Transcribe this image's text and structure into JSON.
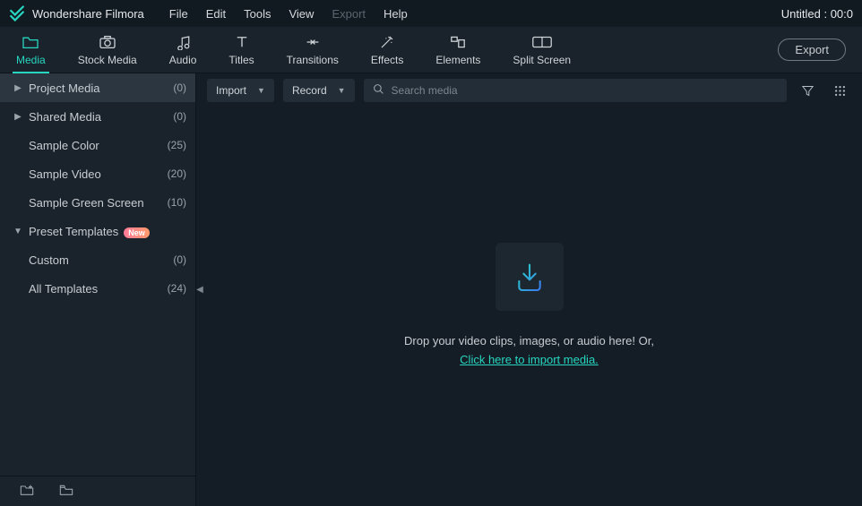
{
  "titlebar": {
    "app_name": "Wondershare Filmora",
    "menus": [
      {
        "label": "File",
        "disabled": false
      },
      {
        "label": "Edit",
        "disabled": false
      },
      {
        "label": "Tools",
        "disabled": false
      },
      {
        "label": "View",
        "disabled": false
      },
      {
        "label": "Export",
        "disabled": true
      },
      {
        "label": "Help",
        "disabled": false
      }
    ],
    "right_text": "Untitled : 00:0"
  },
  "toolbar": {
    "tabs": [
      {
        "label": "Media",
        "icon": "folder-icon",
        "active": true
      },
      {
        "label": "Stock Media",
        "icon": "camera-icon",
        "active": false
      },
      {
        "label": "Audio",
        "icon": "music-icon",
        "active": false
      },
      {
        "label": "Titles",
        "icon": "text-icon",
        "active": false
      },
      {
        "label": "Transitions",
        "icon": "transitions-icon",
        "active": false
      },
      {
        "label": "Effects",
        "icon": "effects-icon",
        "active": false
      },
      {
        "label": "Elements",
        "icon": "elements-icon",
        "active": false
      },
      {
        "label": "Split Screen",
        "icon": "split-icon",
        "active": false
      }
    ],
    "export_label": "Export"
  },
  "sidebar": {
    "items": [
      {
        "label": "Project Media",
        "count": "(0)",
        "arrow": "right",
        "active": true,
        "child": false,
        "badge": false
      },
      {
        "label": "Shared Media",
        "count": "(0)",
        "arrow": "right",
        "active": false,
        "child": false,
        "badge": false
      },
      {
        "label": "Sample Color",
        "count": "(25)",
        "arrow": "none",
        "active": false,
        "child": false,
        "badge": false
      },
      {
        "label": "Sample Video",
        "count": "(20)",
        "arrow": "none",
        "active": false,
        "child": false,
        "badge": false
      },
      {
        "label": "Sample Green Screen",
        "count": "(10)",
        "arrow": "none",
        "active": false,
        "child": false,
        "badge": false
      },
      {
        "label": "Preset Templates",
        "count": "",
        "arrow": "down",
        "active": false,
        "child": false,
        "badge": true,
        "badge_text": "New"
      },
      {
        "label": "Custom",
        "count": "(0)",
        "arrow": "none",
        "active": false,
        "child": true,
        "badge": false
      },
      {
        "label": "All Templates",
        "count": "(24)",
        "arrow": "none",
        "active": false,
        "child": true,
        "badge": false
      }
    ]
  },
  "content": {
    "import_label": "Import",
    "record_label": "Record",
    "search_placeholder": "Search media",
    "drop_text_line1": "Drop your video clips, images, or audio here! Or,",
    "drop_link_text": "Click here to import media."
  }
}
